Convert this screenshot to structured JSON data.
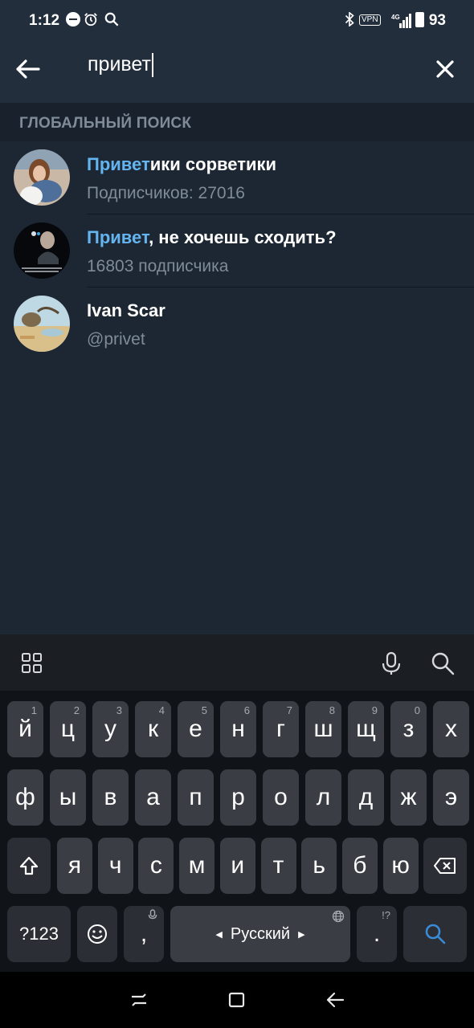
{
  "status_bar": {
    "time": "1:12",
    "vpn": "VPN",
    "network": "4G",
    "battery": "93"
  },
  "search": {
    "query": "привет"
  },
  "section_title": "ГЛОБАЛЬНЫЙ ПОИСК",
  "results": [
    {
      "highlight": "Привет",
      "rest": "ики сорветики",
      "subtitle": "Подписчиков: 27016"
    },
    {
      "highlight": "Привет",
      "rest": ", не хочешь сходить?",
      "subtitle": "16803 подписчика"
    },
    {
      "highlight": "",
      "rest": "Ivan Scar",
      "subtitle": "@privet"
    }
  ],
  "keyboard": {
    "row1": [
      {
        "k": "й",
        "h": "1"
      },
      {
        "k": "ц",
        "h": "2"
      },
      {
        "k": "у",
        "h": "3"
      },
      {
        "k": "к",
        "h": "4"
      },
      {
        "k": "е",
        "h": "5"
      },
      {
        "k": "н",
        "h": "6"
      },
      {
        "k": "г",
        "h": "7"
      },
      {
        "k": "ш",
        "h": "8"
      },
      {
        "k": "щ",
        "h": "9"
      },
      {
        "k": "з",
        "h": "0"
      },
      {
        "k": "х",
        "h": ""
      }
    ],
    "row2": [
      "ф",
      "ы",
      "в",
      "а",
      "п",
      "р",
      "о",
      "л",
      "д",
      "ж",
      "э"
    ],
    "row3": [
      "я",
      "ч",
      "с",
      "м",
      "и",
      "т",
      "ь",
      "б",
      "ю"
    ],
    "symbols_key": "?123",
    "comma_key": ",",
    "space_label": "Русский",
    "period_key": ".",
    "period_hint": "!?"
  },
  "colors": {
    "background": "#1d2733",
    "header": "#232e3c",
    "accent": "#64b5ef",
    "secondary_text": "#7f8b98"
  }
}
